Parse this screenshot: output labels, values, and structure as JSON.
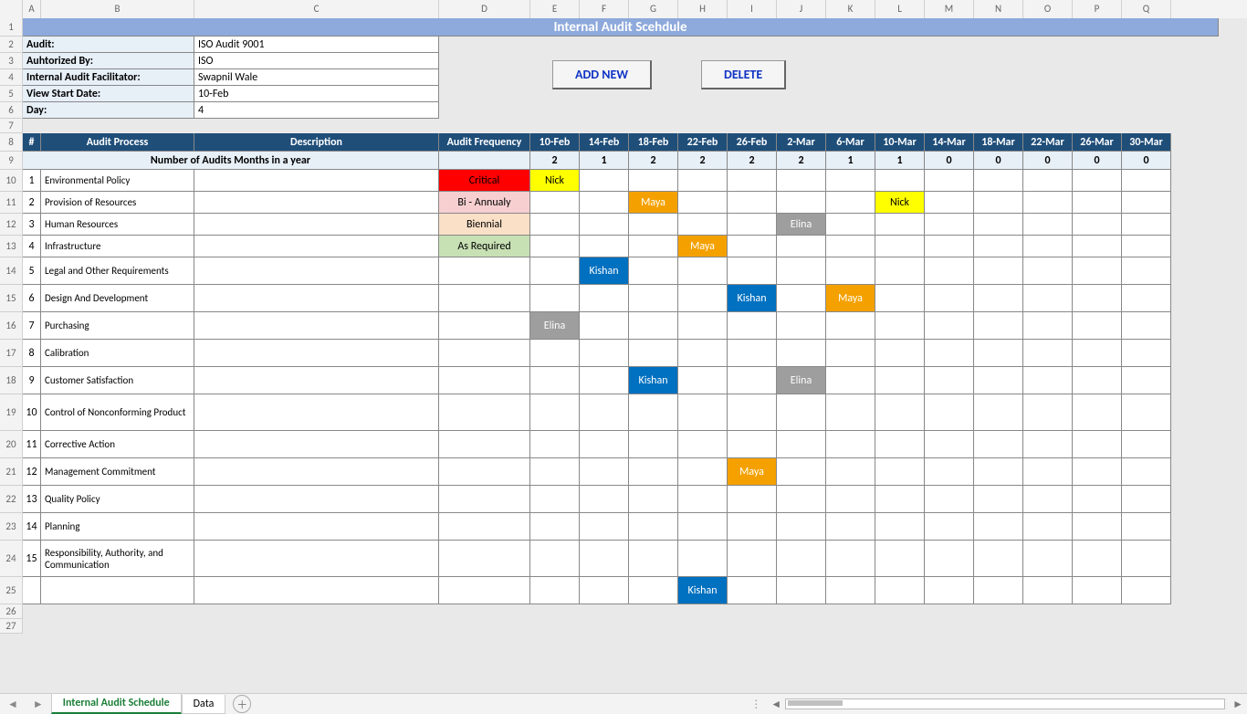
{
  "columns": [
    "A",
    "B",
    "C",
    "D",
    "E",
    "F",
    "G",
    "H",
    "I",
    "J",
    "K",
    "L",
    "M",
    "N",
    "O",
    "P",
    "Q"
  ],
  "title": "Internal Audit Scehdule",
  "buttons": {
    "add": "ADD NEW",
    "delete": "DELETE"
  },
  "info": {
    "audit_label": "Audit:",
    "audit_value": "ISO Audit 9001",
    "auth_label": "Auhtorized By:",
    "auth_value": "ISO",
    "fac_label": "Internal Audit Facilitator:",
    "fac_value": "Swapnil Wale",
    "view_label": "View Start Date:",
    "view_value": "10-Feb",
    "day_label": "Day:",
    "day_value": "4"
  },
  "grid_headers": {
    "num": "#",
    "process": "Audit Process",
    "desc": "Description",
    "freq": "Audit Frequency"
  },
  "dates": [
    "10-Feb",
    "14-Feb",
    "18-Feb",
    "22-Feb",
    "26-Feb",
    "2-Mar",
    "6-Mar",
    "10-Mar",
    "14-Mar",
    "18-Mar",
    "22-Mar",
    "26-Mar",
    "30-Mar"
  ],
  "counts_label": "Number of Audits Months in a year",
  "counts": [
    "2",
    "1",
    "2",
    "2",
    "2",
    "2",
    "1",
    "1",
    "0",
    "0",
    "0",
    "0",
    "0"
  ],
  "rows": [
    {
      "n": "1",
      "proc": "Environmental Policy",
      "freq": "Critical",
      "freq_cls": "freq-red",
      "cells": {
        "0": {
          "t": "Nick",
          "c": "p-yellow"
        }
      }
    },
    {
      "n": "2",
      "proc": "Provision of Resources",
      "freq": "Bi - Annualy",
      "freq_cls": "freq-pink",
      "cells": {
        "2": {
          "t": "Maya",
          "c": "p-orange"
        },
        "7": {
          "t": "Nick",
          "c": "p-yellow"
        }
      }
    },
    {
      "n": "3",
      "proc": "Human Resources",
      "freq": "Biennial",
      "freq_cls": "freq-tan",
      "cells": {
        "5": {
          "t": "Elina",
          "c": "p-grey"
        }
      }
    },
    {
      "n": "4",
      "proc": "Infrastructure",
      "freq": "As Required",
      "freq_cls": "freq-green",
      "cells": {
        "3": {
          "t": "Maya",
          "c": "p-orange"
        }
      }
    },
    {
      "n": "5",
      "proc": "Legal and Other Requirements",
      "cells": {
        "1": {
          "t": "Kishan",
          "c": "p-blue"
        }
      }
    },
    {
      "n": "6",
      "proc": "Design And Development",
      "cells": {
        "4": {
          "t": "Kishan",
          "c": "p-blue"
        },
        "6": {
          "t": "Maya",
          "c": "p-orange"
        }
      }
    },
    {
      "n": "7",
      "proc": "Purchasing",
      "cells": {
        "0": {
          "t": "Elina",
          "c": "p-grey"
        }
      }
    },
    {
      "n": "8",
      "proc": "Calibration",
      "cells": {}
    },
    {
      "n": "9",
      "proc": "Customer Satisfaction",
      "cells": {
        "2": {
          "t": "Kishan",
          "c": "p-blue"
        },
        "5": {
          "t": "Elina",
          "c": "p-grey"
        }
      }
    },
    {
      "n": "10",
      "proc": "Control of Nonconforming Product",
      "cells": {},
      "tall": true
    },
    {
      "n": "11",
      "proc": "Corrective Action",
      "cells": {}
    },
    {
      "n": "12",
      "proc": "Management Commitment",
      "cells": {
        "4": {
          "t": "Maya",
          "c": "p-orange"
        }
      }
    },
    {
      "n": "13",
      "proc": "Quality Policy",
      "cells": {}
    },
    {
      "n": "14",
      "proc": "Planning",
      "cells": {}
    },
    {
      "n": "15",
      "proc": "Responsibility, Authority, and Communication",
      "cells": {},
      "tall": true
    },
    {
      "n": "",
      "proc": "",
      "cells": {
        "3": {
          "t": "Kishan",
          "c": "p-blue"
        }
      }
    }
  ],
  "tabs": {
    "active": "Internal Audit Schedule",
    "other": "Data"
  },
  "row_nums": [
    "1",
    "2",
    "3",
    "4",
    "5",
    "6",
    "7",
    "8",
    "9",
    "10",
    "11",
    "12",
    "13",
    "14",
    "15",
    "16",
    "17",
    "18",
    "19",
    "20",
    "21",
    "22",
    "23",
    "24",
    "25",
    "26",
    "27"
  ],
  "col_widths": {
    "gutter": 25,
    "A": 20,
    "B": 168,
    "C": 268,
    "D": 100,
    "date": 54
  }
}
